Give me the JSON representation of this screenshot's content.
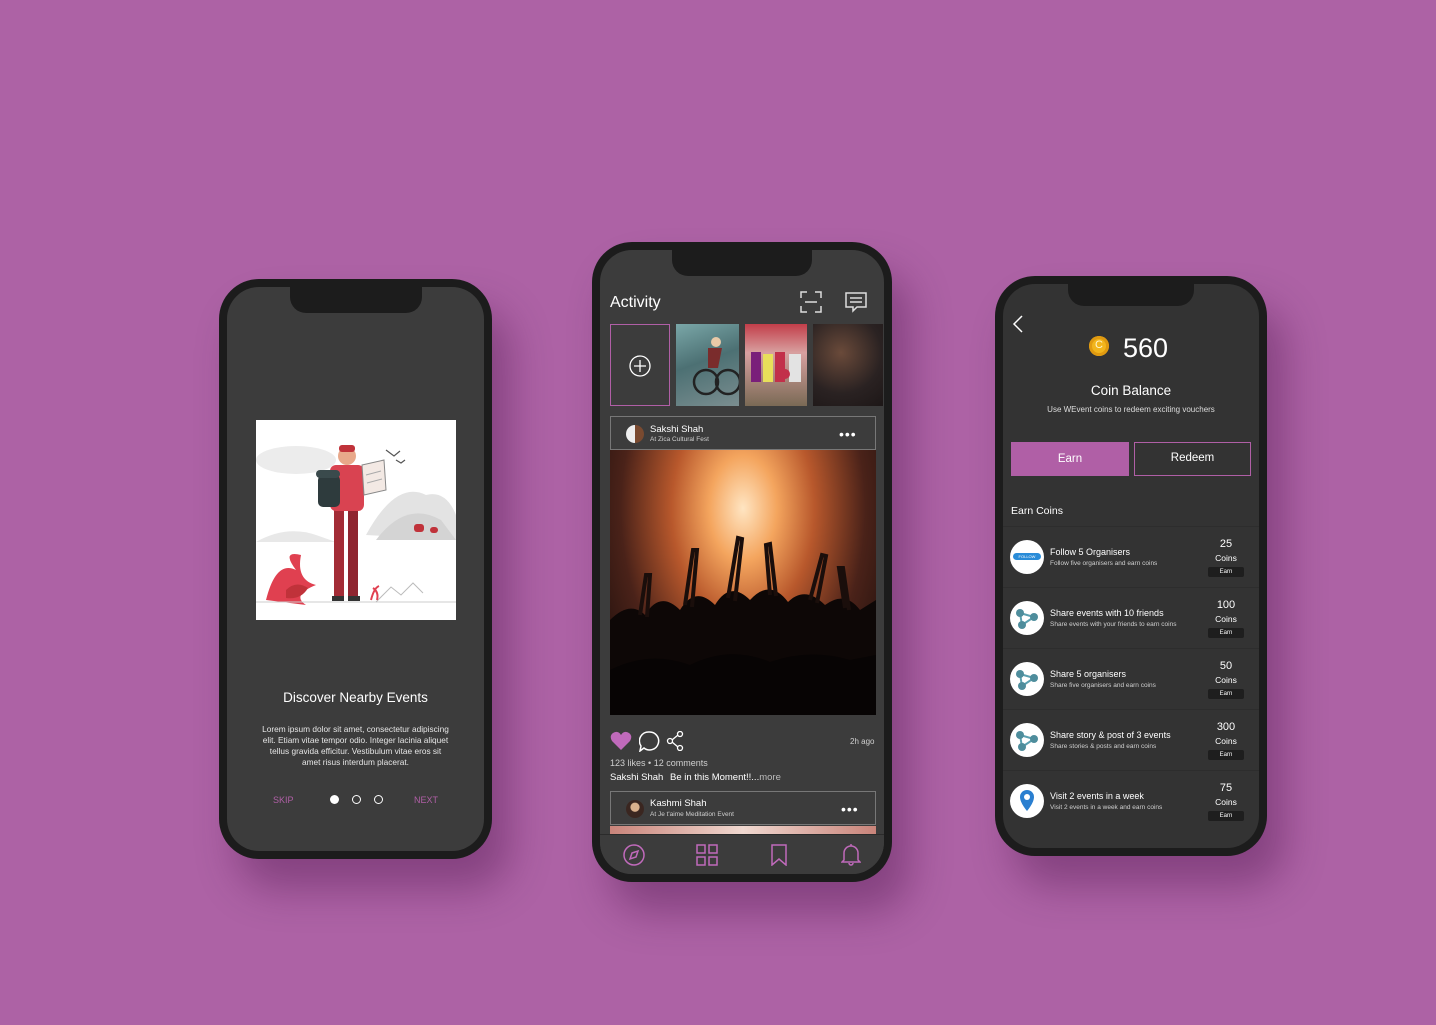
{
  "onboarding": {
    "title": "Discover Nearby Events",
    "body": "Lorem ipsum dolor sit amet, consectetur adipiscing elit. Etiam vitae tempor odio. Integer lacinia aliquet tellus gravida efficitur. Vestibulum vitae eros sit amet risus interdum placerat.",
    "skip_label": "SKIP",
    "next_label": "NEXT",
    "page_index": 1,
    "page_count": 3
  },
  "activity": {
    "title": "Activity",
    "post1": {
      "author": "Sakshi Shah",
      "location": "At Zica Cultural Fest",
      "time": "2h ago",
      "likes": "123 likes",
      "comments": "12 comments",
      "caption_author": "Sakshi Shah",
      "caption": "Be in this Moment!!...",
      "more": "more"
    },
    "post2": {
      "author": "Kashmi Shah",
      "location": "At Je t'aime Meditation Event"
    }
  },
  "coins": {
    "balance": "560",
    "balance_label": "Coin Balance",
    "subtitle": "Use WEvent coins to redeem exciting vouchers",
    "earn_tab": "Earn",
    "redeem_tab": "Redeem",
    "section_title": "Earn Coins",
    "tasks": [
      {
        "title": "Follow 5 Organisers",
        "sub": "Follow five organisers and earn coins",
        "coins": "25",
        "unit": "Coins",
        "action": "Earn",
        "icon": "follow-icon"
      },
      {
        "title": "Share events with 10 friends",
        "sub": "Share events with your friends to earn coins",
        "coins": "100",
        "unit": "Coins",
        "action": "Earn",
        "icon": "share-icon"
      },
      {
        "title": "Share 5 organisers",
        "sub": "Share five organisers and earn coins",
        "coins": "50",
        "unit": "Coins",
        "action": "Earn",
        "icon": "share-icon"
      },
      {
        "title": "Share story & post of 3 events",
        "sub": "Share stories & posts and earn coins",
        "coins": "300",
        "unit": "Coins",
        "action": "Earn",
        "icon": "share-icon"
      },
      {
        "title": "Visit 2 events in a week",
        "sub": "Visit 2 events in a week and earn coins",
        "coins": "75",
        "unit": "Coins",
        "action": "Earn",
        "icon": "location-pin-icon"
      }
    ]
  },
  "follow_badge": "FOLLOW",
  "colors": {
    "background": "#ad62a5",
    "accent": "#b05fa6",
    "screen": "#3c3c3c",
    "coin": "#f2b51c"
  }
}
